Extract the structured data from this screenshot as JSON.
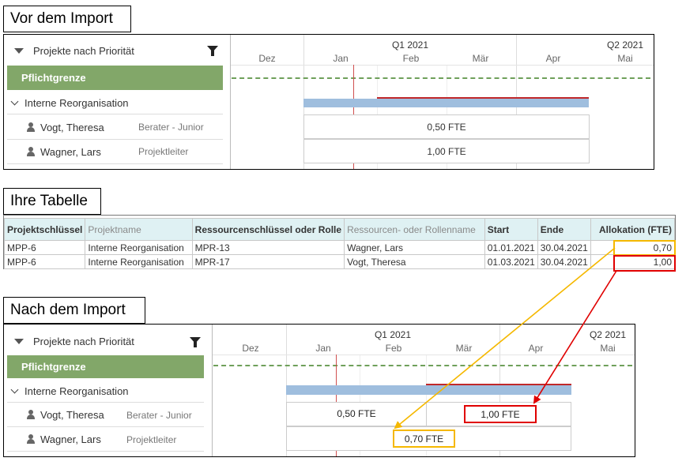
{
  "sections": {
    "before": "Vor dem Import",
    "table": "Ihre Tabelle",
    "after": "Nach dem Import"
  },
  "gantt": {
    "group_label": "Projekte nach Priorität",
    "milestone_label": "Pflichtgrenze",
    "project_label": "Interne Reorganisation",
    "quarters": [
      "Q1 2021",
      "Q2 2021"
    ],
    "months": [
      "Dez",
      "Jan",
      "Feb",
      "Mär",
      "Apr",
      "Mai"
    ],
    "colors": {
      "milestone": "#82a769",
      "bar": "#9fbede",
      "today": "#d05050",
      "highlight_yellow": "#f5b800",
      "highlight_red": "#e00000"
    }
  },
  "before": {
    "resources": [
      {
        "name": "Vogt, Theresa",
        "role": "Berater - Junior",
        "allocation": "0,50 FTE"
      },
      {
        "name": "Wagner, Lars",
        "role": "Projektleiter",
        "allocation": "1,00 FTE"
      }
    ]
  },
  "after": {
    "resources": [
      {
        "name": "Vogt, Theresa",
        "role": "Berater - Junior",
        "allocation_1": "0,50 FTE",
        "allocation_2": "1,00 FTE"
      },
      {
        "name": "Wagner, Lars",
        "role": "Projektleiter",
        "allocation": "0,70 FTE"
      }
    ]
  },
  "table": {
    "headers": [
      "Projektschlüssel",
      "Projektname",
      "Ressourcenschlüssel oder Rolle",
      "Ressourcen- oder Rollenname",
      "Start",
      "Ende",
      "Allokation (FTE)"
    ],
    "rows": [
      [
        "MPP-6",
        "Interne Reorganisation",
        "MPR-13",
        "Wagner, Lars",
        "01.01.2021",
        "30.04.2021",
        "0,70"
      ],
      [
        "MPP-6",
        "Interne Reorganisation",
        "MPR-17",
        "Vogt, Theresa",
        "01.03.2021",
        "30.04.2021",
        "1,00"
      ]
    ]
  }
}
